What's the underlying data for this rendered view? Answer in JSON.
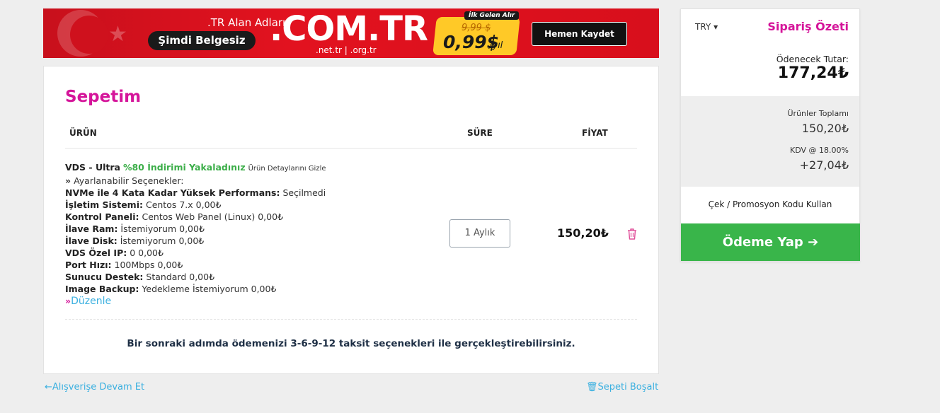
{
  "banner": {
    "tr_domains": ".TR Alan Adları",
    "free_now": "Şimdi Belgesiz",
    "domain": ".COM.TR",
    "subdomains": ".net.tr  |  .org.tr",
    "first_year_tag": "İlk Gelen Alır",
    "old_price": "9,99 $",
    "new_price": "0,99$",
    "per_year": "/yıl",
    "register_label": "Hemen Kaydet"
  },
  "cart": {
    "title": "Sepetim",
    "headers": {
      "product": "ÜRÜN",
      "duration": "SÜRE",
      "price": "FİYAT"
    },
    "item": {
      "name": "VDS - Ultra",
      "discount": "%80 İndirimi Yakaladınız",
      "hide_details": "Ürün Detaylarını Gizle",
      "options_title": "Ayarlanabilir Seçenekler:",
      "options": [
        {
          "label": "NVMe ile 4 Kata Kadar Yüksek Performans:",
          "value": "Seçilmedi"
        },
        {
          "label": "İşletim Sistemi:",
          "value": "Centos 7.x 0,00₺"
        },
        {
          "label": "Kontrol Paneli:",
          "value": "Centos Web Panel (Linux) 0,00₺"
        },
        {
          "label": "İlave Ram:",
          "value": "İstemiyorum 0,00₺"
        },
        {
          "label": "İlave Disk:",
          "value": "İstemiyorum 0,00₺"
        },
        {
          "label": "VDS Özel IP:",
          "value": "0 0,00₺"
        },
        {
          "label": "Port Hızı:",
          "value": "100Mbps 0,00₺"
        },
        {
          "label": "Sunucu Destek:",
          "value": "Standard 0,00₺"
        },
        {
          "label": "Image Backup:",
          "value": "Yedekleme İstemiyorum 0,00₺"
        }
      ],
      "edit_label": "Düzenle",
      "duration": "1 Aylık",
      "price": "150,20₺"
    },
    "installment_note": "Bir sonraki adımda ödemenizi 3-6-9-12 taksit seçenekleri ile gerçekleştirebilirsiniz."
  },
  "links": {
    "continue_shopping": "Alışverişe Devam Et",
    "empty_cart": "Sepeti Boşalt"
  },
  "summary": {
    "currency": "TRY",
    "title": "Sipariş Özeti",
    "pay_label": "Ödenecek Tutar:",
    "pay_amount": "177,24₺",
    "subtotal_label": "Ürünler Toplamı",
    "subtotal_value": "150,20₺",
    "tax_label": "KDV @ 18.00%",
    "tax_value": "+27,04₺",
    "promo_label": "Çek / Promosyon Kodu Kullan",
    "checkout_label": "Ödeme Yap"
  },
  "colors": {
    "accent_pink": "#d5159a",
    "discount_green": "#3cae49",
    "link_blue": "#3bb0e0",
    "checkout_green": "#39b54a",
    "banner_red": "#e2121f"
  }
}
